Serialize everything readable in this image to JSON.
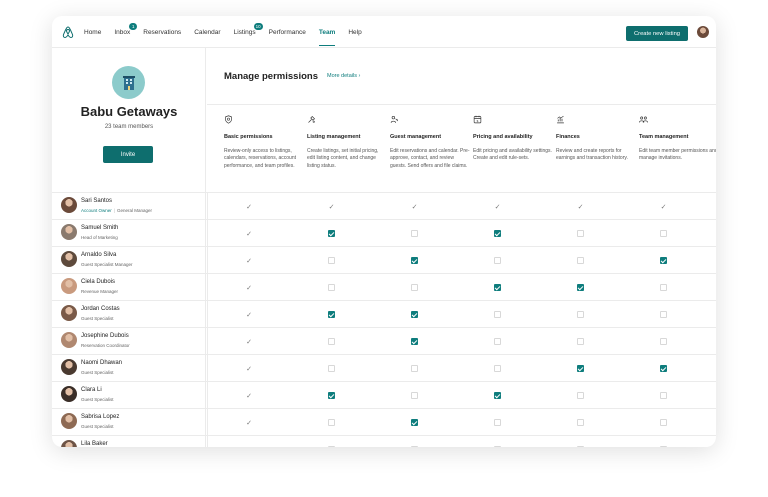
{
  "nav": {
    "items": [
      {
        "label": "Home"
      },
      {
        "label": "Inbox",
        "badge": "1"
      },
      {
        "label": "Reservations"
      },
      {
        "label": "Calendar"
      },
      {
        "label": "Listings",
        "badge": "10"
      },
      {
        "label": "Performance"
      },
      {
        "label": "Team",
        "active": true
      },
      {
        "label": "Help"
      }
    ],
    "create_listing_label": "Create new listing"
  },
  "team": {
    "name": "Babu Getaways",
    "member_count": "23 team members",
    "invite_label": "Invite"
  },
  "permissions": {
    "title": "Manage permissions",
    "more_details": "More details",
    "columns": [
      {
        "name": "Basic permissions",
        "icon": "shield-icon",
        "description": "Review-only access to listings, calendars, reservations, account performance, and team profiles."
      },
      {
        "name": "Listing management",
        "icon": "tools-icon",
        "description": "Create listings, set initial pricing, edit listing content, and change listing status."
      },
      {
        "name": "Guest management",
        "icon": "guest-key-icon",
        "description": "Edit reservations and calendar. Pre-approve, contact, and review guests. Send offers and file claims."
      },
      {
        "name": "Pricing and availability",
        "icon": "calendar-price-icon",
        "description": "Edit pricing and availability settings. Create and edit rule-sets."
      },
      {
        "name": "Finances",
        "icon": "finance-chart-icon",
        "description": "Review and create reports for earnings and transaction history."
      },
      {
        "name": "Team management",
        "icon": "team-icon",
        "description": "Edit team member permissions and manage invitations."
      }
    ]
  },
  "members": [
    {
      "name": "Sari Santos",
      "owner_tag": "Account Owner",
      "role": "General Manager",
      "perms": [
        "static",
        "static",
        "static",
        "static",
        "static",
        "static"
      ],
      "avatar_color": "#6b4a3a"
    },
    {
      "name": "Samuel Smith",
      "role": "Head of Marketing",
      "perms": [
        "static",
        "on",
        "off",
        "on",
        "off",
        "off"
      ],
      "avatar_color": "#8a7a6e"
    },
    {
      "name": "Arnaldo Silva",
      "role": "Guest Specialist Manager",
      "perms": [
        "static",
        "off",
        "on",
        "off",
        "off",
        "on"
      ],
      "avatar_color": "#5e4a3c"
    },
    {
      "name": "Ciela Dubois",
      "role": "Revenue Manager",
      "perms": [
        "static",
        "off",
        "off",
        "on",
        "on",
        "off"
      ],
      "avatar_color": "#c99a7e"
    },
    {
      "name": "Jordan Costas",
      "role": "Guest Specialist",
      "perms": [
        "static",
        "on",
        "on",
        "off",
        "off",
        "off"
      ],
      "avatar_color": "#7a5a48"
    },
    {
      "name": "Josephine Dubois",
      "role": "Reservation Coordinator",
      "perms": [
        "static",
        "off",
        "on",
        "off",
        "off",
        "off"
      ],
      "avatar_color": "#b08870"
    },
    {
      "name": "Naomi Dhawan",
      "role": "Guest Specialist",
      "perms": [
        "static",
        "off",
        "off",
        "off",
        "on",
        "on"
      ],
      "avatar_color": "#4a3a30"
    },
    {
      "name": "Clara Li",
      "role": "Guest Specialist",
      "perms": [
        "static",
        "on",
        "off",
        "on",
        "off",
        "off"
      ],
      "avatar_color": "#3a2e28"
    },
    {
      "name": "Sabrisa Lopez",
      "role": "Guest Specialist",
      "perms": [
        "static",
        "off",
        "on",
        "off",
        "off",
        "off"
      ],
      "avatar_color": "#8e6a54"
    },
    {
      "name": "Lila Baker",
      "role": "",
      "perms": [
        "static",
        "off",
        "off",
        "off",
        "off",
        "off"
      ],
      "avatar_color": "#6e5446"
    }
  ],
  "colors": {
    "accent": "#0e7d7d",
    "button": "#0e6e6e",
    "team_logo_bg": "#8ccbcb"
  }
}
